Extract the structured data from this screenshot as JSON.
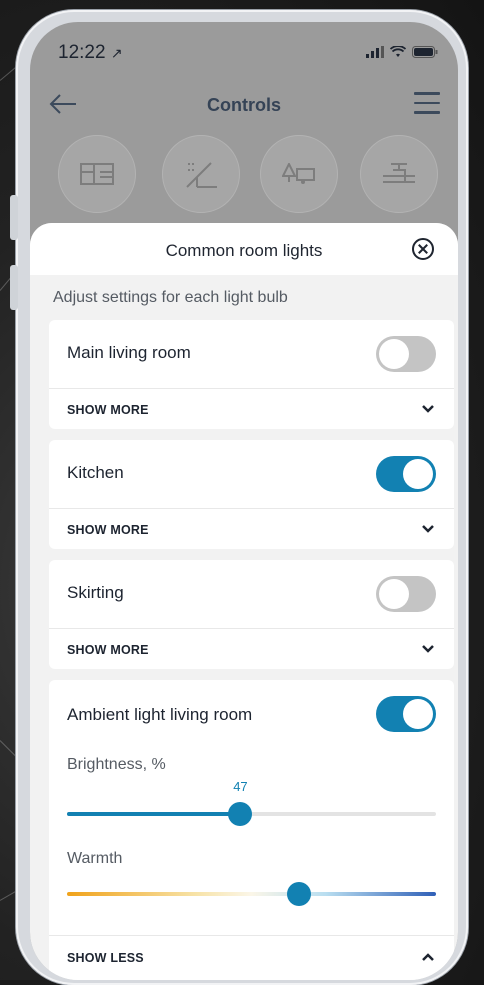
{
  "status": {
    "time": "12:22"
  },
  "header": {
    "title": "Controls"
  },
  "categories": [
    {
      "icon": "floor-plan-icon"
    },
    {
      "icon": "shower-icon"
    },
    {
      "icon": "camper-tree-icon"
    },
    {
      "icon": "valve-pipe-icon"
    }
  ],
  "sheet": {
    "title": "Common room lights",
    "subtitle": "Adjust settings for each light bulb"
  },
  "lights": [
    {
      "name": "Main living room",
      "on": false,
      "expand_label": "SHOW MORE"
    },
    {
      "name": "Kitchen",
      "on": true,
      "expand_label": "SHOW MORE"
    },
    {
      "name": "Skirting",
      "on": false,
      "expand_label": "SHOW MORE"
    },
    {
      "name": "Ambient light living room",
      "on": true,
      "expand_label": "SHOW LESS",
      "brightness_label": "Brightness, %",
      "brightness_value": "47",
      "warmth_label": "Warmth",
      "warmth_fraction": 0.63
    }
  ],
  "colors": {
    "accent": "#1281b2",
    "toggle_off": "#c4c4c4"
  }
}
